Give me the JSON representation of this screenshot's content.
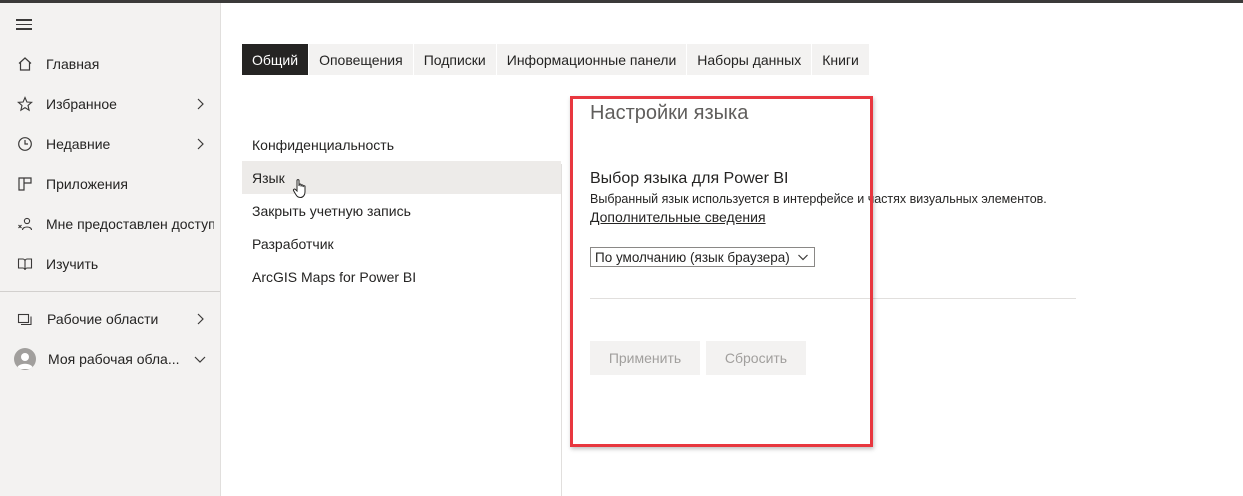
{
  "sidebar": {
    "items": [
      {
        "label": "Главная",
        "icon": "home-icon",
        "chevron": false
      },
      {
        "label": "Избранное",
        "icon": "star-icon",
        "chevron": true
      },
      {
        "label": "Недавние",
        "icon": "clock-icon",
        "chevron": true
      },
      {
        "label": "Приложения",
        "icon": "apps-icon",
        "chevron": false
      },
      {
        "label": "Мне предоставлен доступ",
        "icon": "shared-icon",
        "chevron": false
      },
      {
        "label": "Изучить",
        "icon": "book-icon",
        "chevron": false
      }
    ],
    "workspaces": {
      "label": "Рабочие области",
      "icon": "workspaces-icon"
    },
    "my_workspace": {
      "label": "Моя рабочая обла...",
      "icon": "avatar-icon"
    }
  },
  "tabs": [
    {
      "label": "Общий",
      "active": true
    },
    {
      "label": "Оповещения",
      "active": false
    },
    {
      "label": "Подписки",
      "active": false
    },
    {
      "label": "Информационные панели",
      "active": false
    },
    {
      "label": "Наборы данных",
      "active": false
    },
    {
      "label": "Книги",
      "active": false
    }
  ],
  "settings_menu": [
    {
      "label": "Конфиденциальность",
      "selected": false
    },
    {
      "label": "Язык",
      "selected": true
    },
    {
      "label": "Закрыть учетную запись",
      "selected": false
    },
    {
      "label": "Разработчик",
      "selected": false
    },
    {
      "label": "ArcGIS Maps for Power BI",
      "selected": false
    }
  ],
  "panel": {
    "title": "Настройки языка",
    "section_title": "Выбор языка для Power BI",
    "description": "Выбранный язык используется в интерфейсе и частях визуальных элементов.",
    "more_link": "Дополнительные сведения",
    "language_select": "По умолчанию (язык браузера)",
    "apply_label": "Применить",
    "reset_label": "Сбросить"
  },
  "colors": {
    "accent_dark": "#252423",
    "highlight": "#e8373f",
    "sidebar_bg": "#f3f2f1"
  }
}
